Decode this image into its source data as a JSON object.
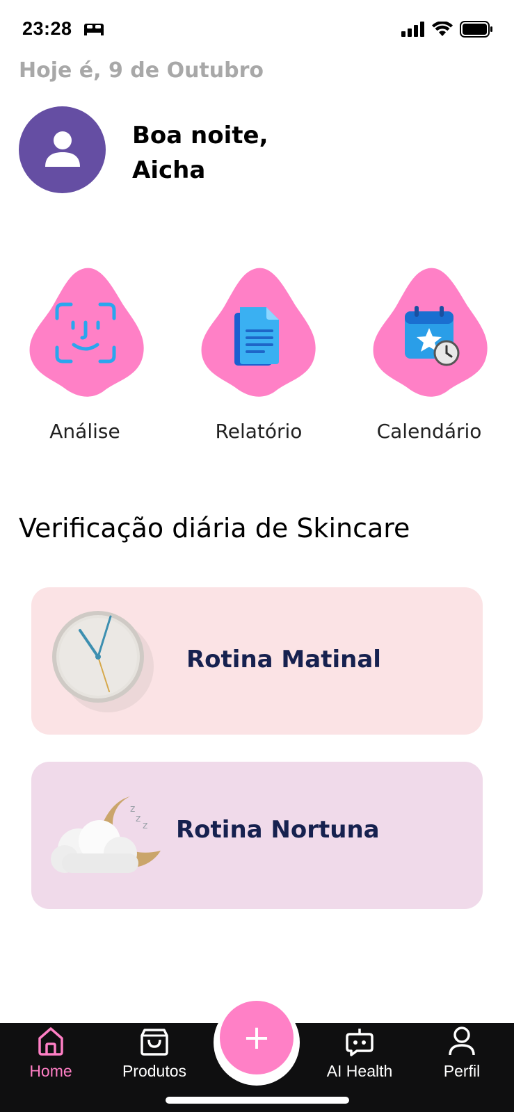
{
  "status_bar": {
    "time": "23:28"
  },
  "header": {
    "date_text": "Hoje é, 9 de Outubro",
    "greeting_line1": "Boa noite,",
    "greeting_line2": "Aicha"
  },
  "features": [
    {
      "label": "Análise",
      "icon": "face-scan-icon"
    },
    {
      "label": "Relatório",
      "icon": "document-icon"
    },
    {
      "label": "Calendário",
      "icon": "calendar-icon"
    }
  ],
  "section": {
    "title": "Verificação diária de Skincare"
  },
  "routines": [
    {
      "label": "Rotina Matinal",
      "icon": "clock-icon"
    },
    {
      "label": "Rotina Nortuna",
      "icon": "moon-cloud-icon"
    }
  ],
  "tab_bar": {
    "items": [
      {
        "label": "Home",
        "icon": "home-icon",
        "active": true
      },
      {
        "label": "Produtos",
        "icon": "shopping-bag-icon"
      },
      {
        "label": "AI Health",
        "icon": "robot-icon"
      },
      {
        "label": "Perfil",
        "icon": "user-icon"
      }
    ],
    "fab_symbol": "+",
    "fab_icon": "plus-icon"
  },
  "colors": {
    "accent_pink": "#ff80c6",
    "avatar_purple": "#654ea3",
    "card_morning": "#fbe3e5",
    "card_night": "#f0daea",
    "routine_text": "#16214f",
    "tab_bar_bg": "#0f0f10"
  }
}
